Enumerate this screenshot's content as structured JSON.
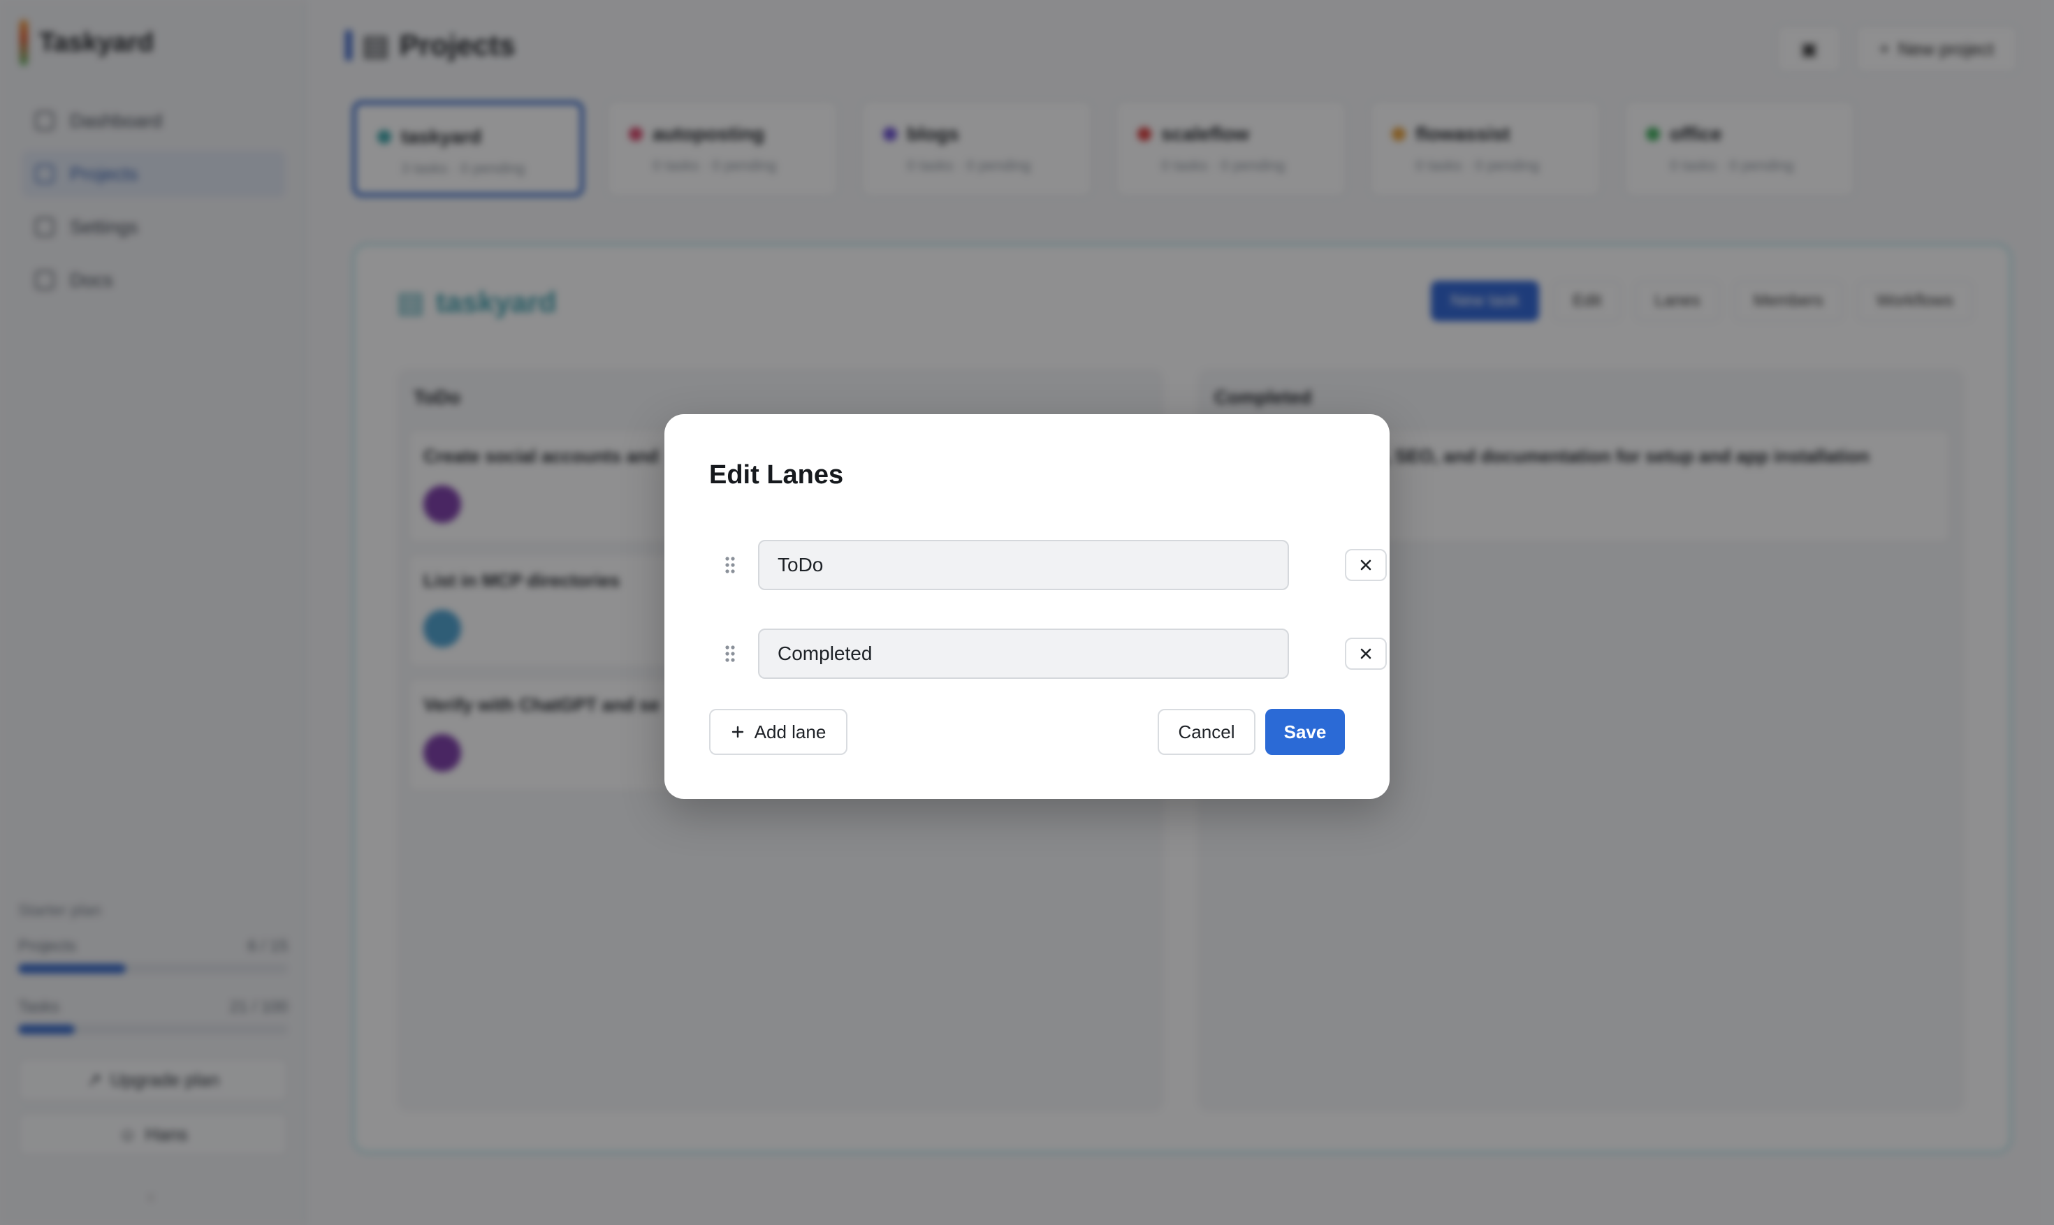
{
  "app": {
    "name": "Taskyard"
  },
  "sidebar": {
    "items": [
      {
        "label": "Dashboard"
      },
      {
        "label": "Projects"
      },
      {
        "label": "Settings"
      },
      {
        "label": "Docs"
      }
    ],
    "usage": {
      "title": "Starter plan",
      "projects_label": "Projects",
      "projects_value": "6 / 15",
      "projects_fraction": 0.4,
      "tasks_label": "Tasks",
      "tasks_value": "21 / 100",
      "tasks_fraction": 0.21
    },
    "upgrade_label": "Upgrade plan",
    "user_label": "Hans"
  },
  "header": {
    "title": "Projects",
    "new_project_label": "New project"
  },
  "projects": [
    {
      "name": "taskyard",
      "meta": "3 tasks · 0 pending",
      "color": "#3aa3a8"
    },
    {
      "name": "autoposting",
      "meta": "0 tasks · 0 pending",
      "color": "#d9456a"
    },
    {
      "name": "blogs",
      "meta": "0 tasks · 0 pending",
      "color": "#6a4fd1"
    },
    {
      "name": "scaleflow",
      "meta": "0 tasks · 0 pending",
      "color": "#d93a3a"
    },
    {
      "name": "flowassist",
      "meta": "0 tasks · 0 pending",
      "color": "#e8a13b"
    },
    {
      "name": "office",
      "meta": "0 tasks · 0 pending",
      "color": "#3fae5c"
    }
  ],
  "board": {
    "title": "taskyard",
    "actions": [
      "New task",
      "Edit",
      "Lanes",
      "Members",
      "Workflows"
    ],
    "lanes": [
      {
        "title": "ToDo",
        "cards": [
          {
            "title": "Create social accounts and",
            "avatar_color": "#7b3aa8"
          },
          {
            "title": "List in MCP directories",
            "avatar_color": "#4aa0cf"
          },
          {
            "title": "Verify with ChatGPT and se",
            "avatar_color": "#7b3aa8"
          }
        ]
      },
      {
        "title": "Completed",
        "cards": [
          {
            "title": "ps, SEO, and documentation for setup and app installation"
          }
        ]
      }
    ]
  },
  "modal": {
    "title": "Edit Lanes",
    "lanes": [
      {
        "value": "ToDo"
      },
      {
        "value": "Completed"
      }
    ],
    "add_lane_label": "Add lane",
    "cancel_label": "Cancel",
    "save_label": "Save"
  },
  "colors": {
    "primary": "#2b6ad6",
    "overlay": "rgba(18,18,20,0.47)"
  }
}
